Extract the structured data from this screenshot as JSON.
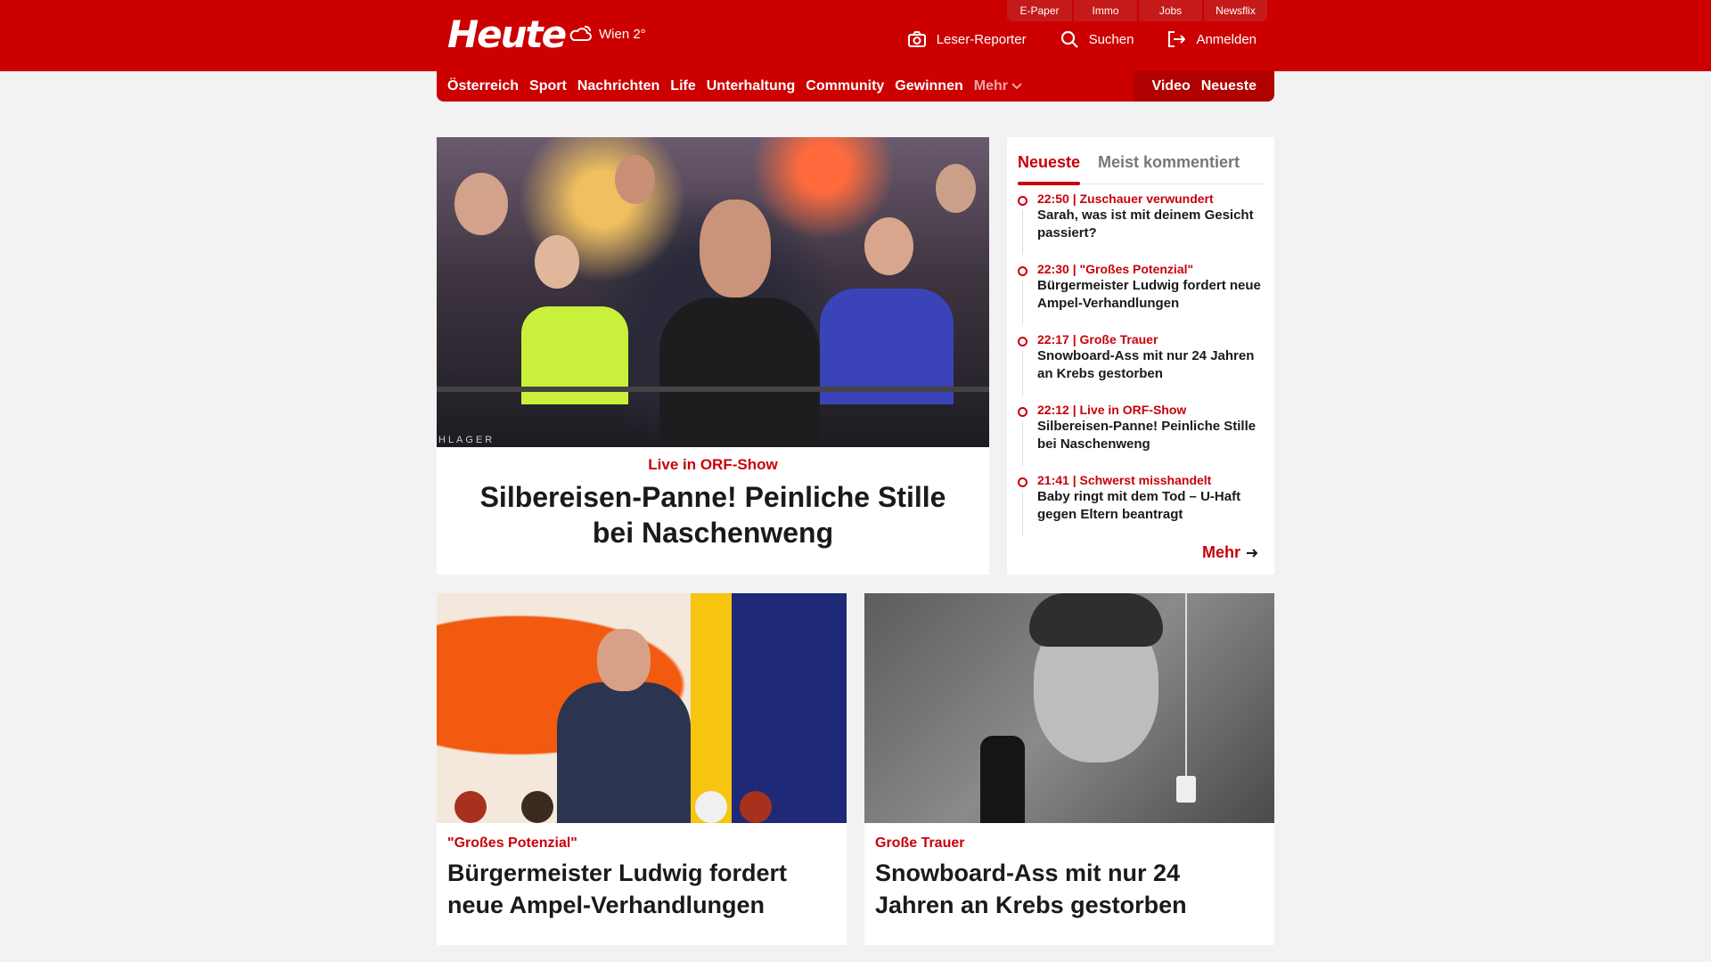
{
  "header": {
    "logo": "Heute",
    "weather": "Wien 2°",
    "util_tabs": [
      "E-Paper",
      "Immo",
      "Jobs",
      "Newsflix"
    ],
    "tools": {
      "reporter": "Leser-Reporter",
      "search": "Suchen",
      "login": "Anmelden"
    }
  },
  "nav": {
    "items": [
      "Österreich",
      "Sport",
      "Nachrichten",
      "Life",
      "Unterhaltung",
      "Community",
      "Gewinnen"
    ],
    "more": "Mehr",
    "right": [
      "Video",
      "Neueste"
    ]
  },
  "hero": {
    "image_watermark": "HLAGER",
    "kicker": "Live in ORF-Show",
    "title": "Silbereisen-Panne! Peinliche Stille bei Naschenweng"
  },
  "sidebar": {
    "tabs": [
      "Neueste",
      "Meist kommentiert"
    ],
    "items": [
      {
        "meta": "22:50 | Zuschauer verwundert",
        "title": "Sarah, was ist mit deinem Gesicht passiert?"
      },
      {
        "meta": "22:30 | \"Großes Potenzial\"",
        "title": "Bürgermeister Ludwig fordert neue Ampel-Verhandlungen"
      },
      {
        "meta": "22:17 | Große Trauer",
        "title": "Snowboard-Ass mit nur 24 Jahren an Krebs gestorben"
      },
      {
        "meta": "22:12 | Live in ORF-Show",
        "title": "Silbereisen-Panne! Peinliche Stille bei Naschenweng"
      },
      {
        "meta": "21:41 | Schwerst misshandelt",
        "title": "Baby ringt mit dem Tod – U-Haft gegen Eltern beantragt"
      }
    ],
    "more": "Mehr"
  },
  "cards": [
    {
      "kicker": "\"Großes Potenzial\"",
      "title": "Bürgermeister Ludwig fordert neue Ampel-Verhandlungen"
    },
    {
      "kicker": "Große Trauer",
      "title": "Snowboard-Ass mit nur 24 Jahren an Krebs gestorben"
    }
  ],
  "colors": {
    "brand_red": "#cc0000",
    "kicker_red": "#c8000a",
    "background": "#f2f2f2"
  }
}
